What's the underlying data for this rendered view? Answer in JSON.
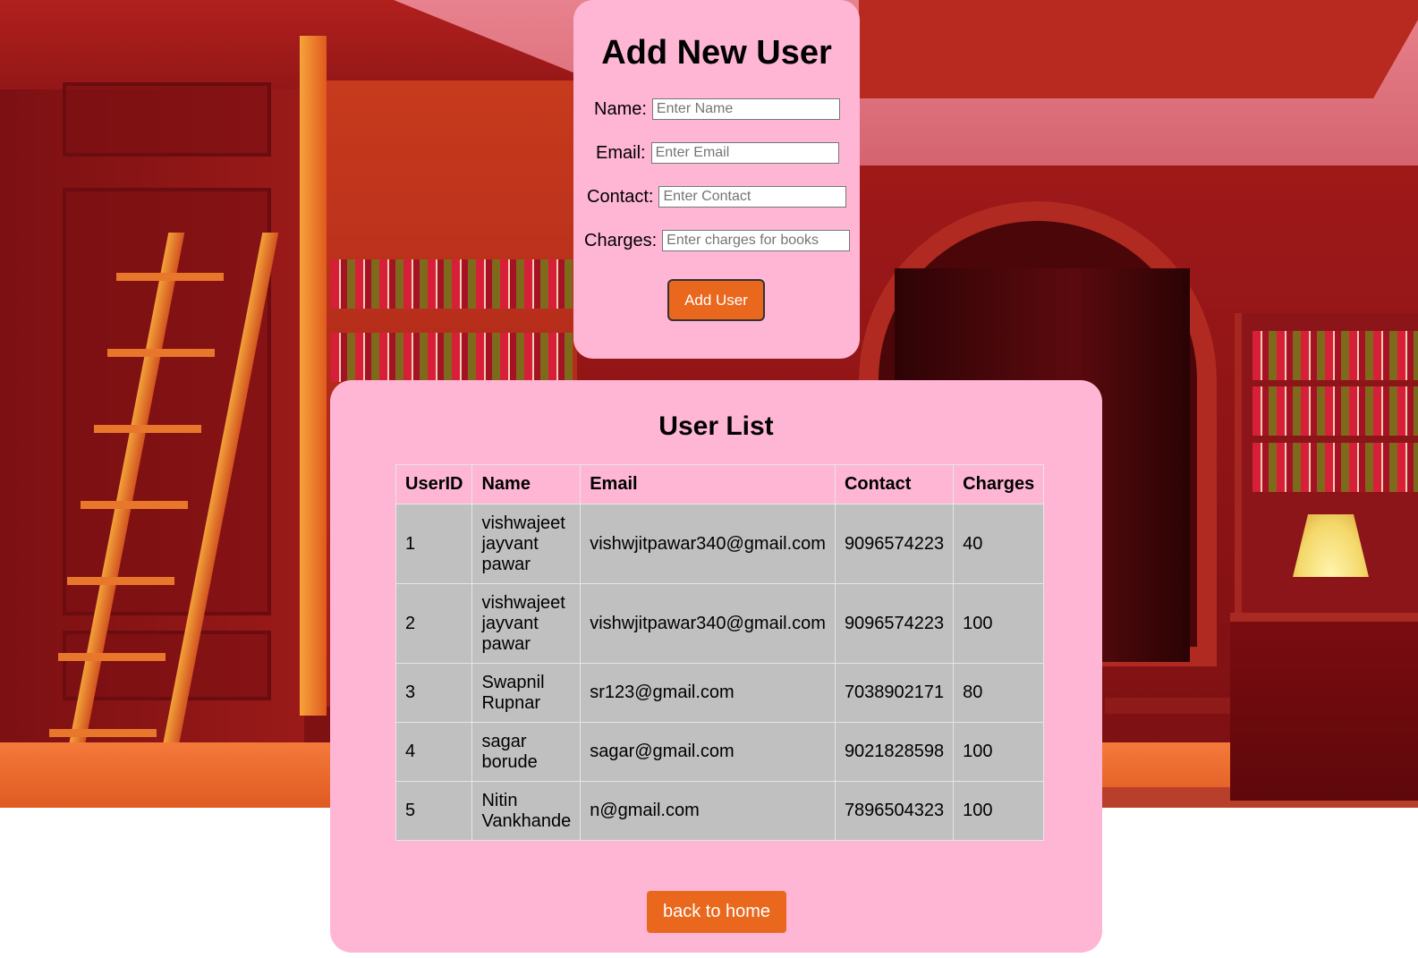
{
  "form": {
    "title": "Add New User",
    "fields": [
      {
        "label": "Name:",
        "placeholder": "Enter Name",
        "value": ""
      },
      {
        "label": "Email:",
        "placeholder": "Enter Email",
        "value": ""
      },
      {
        "label": "Contact:",
        "placeholder": "Enter Contact",
        "value": ""
      },
      {
        "label": "Charges:",
        "placeholder": "Enter charges for books",
        "value": ""
      }
    ],
    "submit_label": "Add User"
  },
  "user_list": {
    "title": "User List",
    "columns": [
      "UserID",
      "Name",
      "Email",
      "Contact",
      "Charges"
    ],
    "rows": [
      {
        "id": "1",
        "name": "vishwajeet jayvant pawar",
        "email": "vishwjitpawar340@gmail.com",
        "contact": "9096574223",
        "charges": "40"
      },
      {
        "id": "2",
        "name": "vishwajeet jayvant pawar",
        "email": "vishwjitpawar340@gmail.com",
        "contact": "9096574223",
        "charges": "100"
      },
      {
        "id": "3",
        "name": "Swapnil Rupnar",
        "email": "sr123@gmail.com",
        "contact": "7038902171",
        "charges": "80"
      },
      {
        "id": "4",
        "name": "sagar borude",
        "email": "sagar@gmail.com",
        "contact": "9021828598",
        "charges": "100"
      },
      {
        "id": "5",
        "name": "Nitin Vankhande",
        "email": "n@gmail.com",
        "contact": "7896504323",
        "charges": "100"
      }
    ]
  },
  "back_label": "back to home",
  "colors": {
    "card_bg": "#ffb6d5",
    "button_bg": "#e9681d",
    "row_bg": "#c0c0c0"
  }
}
